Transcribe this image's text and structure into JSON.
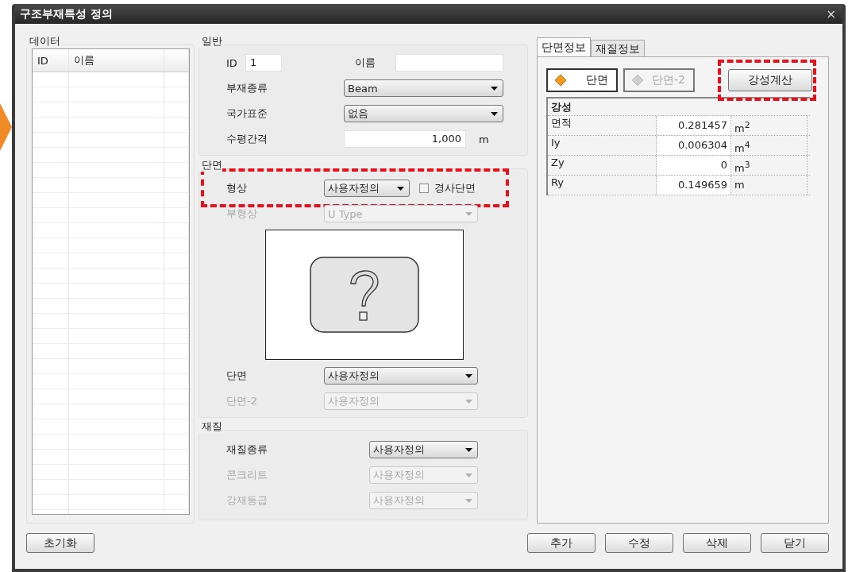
{
  "window": {
    "title": "구조부재특성 정의",
    "close": "×"
  },
  "data": {
    "title": "데이터",
    "columns": [
      "ID",
      "이름"
    ]
  },
  "general": {
    "title": "일반",
    "id": {
      "label": "ID",
      "value": "1"
    },
    "name": {
      "label": "이름"
    },
    "fields": [
      {
        "kind": "select",
        "label": "부재종류",
        "value": "Beam",
        "disabled": false
      },
      {
        "kind": "select",
        "label": "국가표준",
        "value": "없음",
        "disabled": false
      },
      {
        "kind": "number",
        "label": "수평간격",
        "value": "1,000",
        "unit": "m"
      }
    ]
  },
  "section": {
    "title": "단면",
    "shape": {
      "label": "형상",
      "value": "사용자정의",
      "highlighted": true
    },
    "sloped": {
      "label": "경사단면",
      "checked": false
    },
    "fields": [
      {
        "kind": "select",
        "label": "부형상",
        "value": "U Type",
        "disabled": true
      },
      {
        "kind": "preview"
      },
      {
        "kind": "select",
        "label": "단면",
        "value": "사용자정의",
        "disabled": false
      },
      {
        "kind": "select",
        "label": "단면-2",
        "value": "사용자정의",
        "disabled": true
      }
    ]
  },
  "material": {
    "title": "재질",
    "fields": [
      {
        "kind": "select",
        "label": "재질종류",
        "value": "사용자정의",
        "disabled": false
      },
      {
        "kind": "select",
        "label": "콘크리트",
        "value": "사용자정의",
        "disabled": true
      },
      {
        "kind": "select",
        "label": "강재등급",
        "value": "사용자정의",
        "disabled": true
      }
    ]
  },
  "tabs": [
    {
      "label": "단면정보",
      "selected": true
    },
    {
      "label": "재질정보",
      "selected": false
    }
  ],
  "toggles": [
    {
      "label": "단면",
      "disabled": false
    },
    {
      "label": "단면-2",
      "disabled": true
    }
  ],
  "calc_button": {
    "label": "강성계산",
    "highlighted": true
  },
  "stiffness": {
    "title": "강성",
    "rows": [
      {
        "name": "면적",
        "value": "0.281457",
        "unit": "m$^{2}$"
      },
      {
        "name": "Iy",
        "value": "0.006304",
        "unit": "m$^{4}$"
      },
      {
        "name": "Zy",
        "value": "0",
        "unit": "m$^{3}$"
      },
      {
        "name": "Ry",
        "value": "0.149659",
        "unit": "m"
      }
    ]
  },
  "buttons_left": [
    "초기화"
  ],
  "buttons_right": [
    "추가",
    "수정",
    "삭제",
    "닫기"
  ]
}
